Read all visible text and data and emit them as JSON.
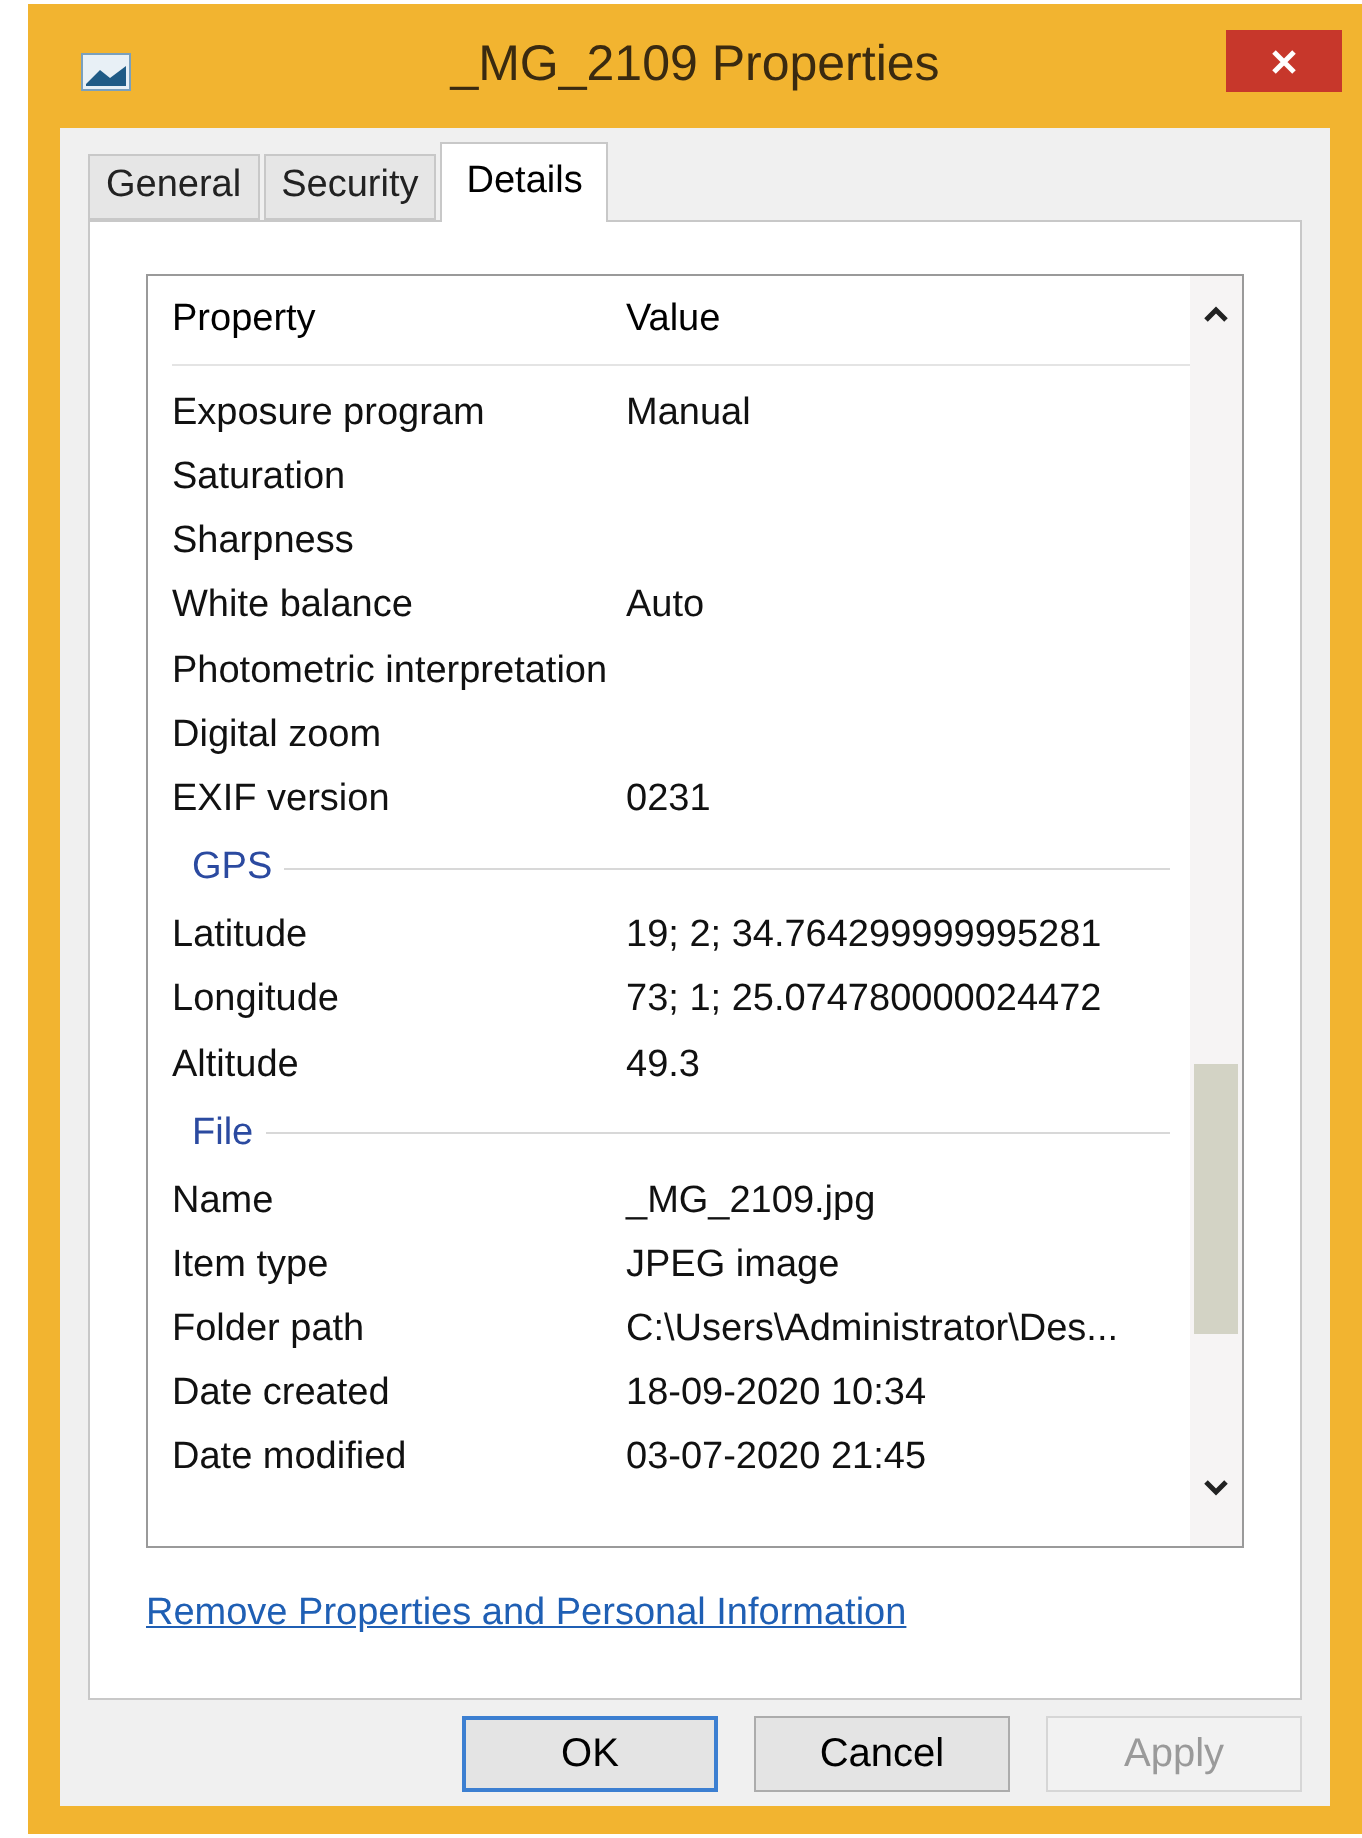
{
  "window": {
    "title": "_MG_2109 Properties"
  },
  "tabs": [
    {
      "label": "General",
      "selected": false
    },
    {
      "label": "Security",
      "selected": false
    },
    {
      "label": "Details",
      "selected": true
    }
  ],
  "table": {
    "columns": [
      "Property",
      "Value"
    ],
    "groups": [
      {
        "rows": [
          {
            "property": "Exposure program",
            "value": "Manual"
          },
          {
            "property": "Saturation"
          },
          {
            "property": "Sharpness"
          },
          {
            "property": "White balance",
            "value": "Auto"
          },
          {
            "property": "Photometric interpretation"
          },
          {
            "property": "Digital zoom"
          },
          {
            "property": "EXIF version",
            "value": "0231"
          }
        ]
      },
      {
        "heading": "GPS",
        "rows": [
          {
            "property": "Latitude",
            "value": "19; 2; 34.764299999995281"
          },
          {
            "property": "Longitude",
            "value": "73; 1; 25.074780000024472"
          },
          {
            "property": "Altitude",
            "value": "49.3"
          }
        ]
      },
      {
        "heading": "File",
        "rows": [
          {
            "property": "Name",
            "value": "_MG_2109.jpg"
          },
          {
            "property": "Item type",
            "value": "JPEG image"
          },
          {
            "property": "Folder path",
            "value": "C:\\Users\\Administrator\\Des..."
          },
          {
            "property": "Date created",
            "value": "18-09-2020 10:34"
          },
          {
            "property": "Date modified",
            "value": "03-07-2020 21:45"
          }
        ]
      }
    ]
  },
  "link": "Remove Properties and Personal Information",
  "buttons": [
    {
      "label": "OK",
      "disabled": false,
      "default": true
    },
    {
      "label": "Cancel",
      "disabled": false,
      "default": false
    },
    {
      "label": "Apply",
      "disabled": true,
      "default": false
    }
  ]
}
